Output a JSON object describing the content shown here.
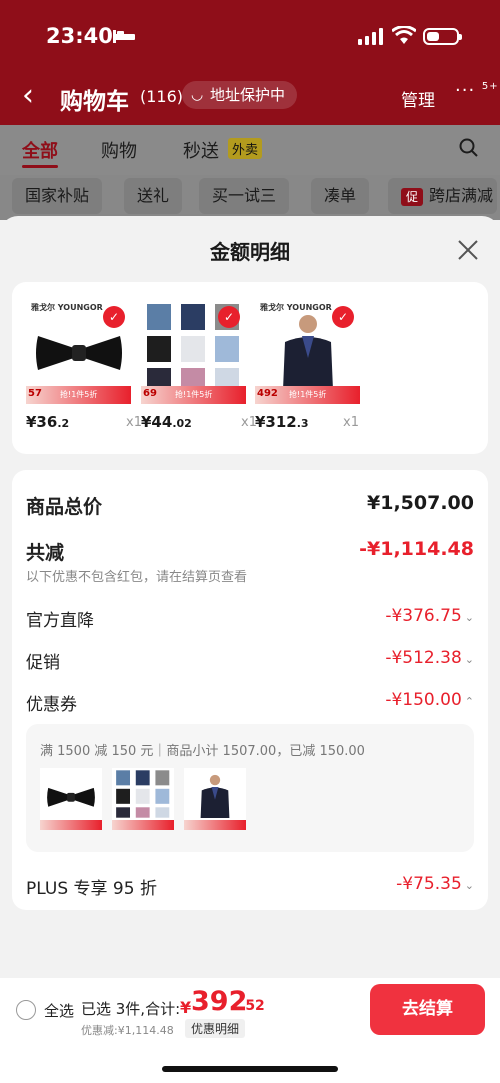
{
  "status": {
    "time": "23:40"
  },
  "header": {
    "back_icon": "chevron-left-icon",
    "title": "购物车",
    "count": "(116)",
    "address_protect": "地址保护中",
    "manage": "管理",
    "more_badge": "5+"
  },
  "tabs": [
    {
      "label": "全部"
    },
    {
      "label": "购物"
    },
    {
      "label": "秒送"
    }
  ],
  "tabs_tag": "外卖",
  "chips": [
    "国家补贴",
    "送礼",
    "买一试三",
    "凑单",
    "跨店满减"
  ],
  "chip_icon": "促",
  "sheet": {
    "title": "金额明细",
    "items": [
      {
        "brand": "雅戈尔 YOUNGOR",
        "banner_num": "57",
        "banner_promo": "抢!1件5折",
        "price_int": "¥36",
        "price_dec": ".2",
        "qty": "x1"
      },
      {
        "brand": "",
        "banner_num": "69",
        "banner_promo": "抢!1件5折",
        "price_int": "¥44",
        "price_dec": ".02",
        "qty": "x1"
      },
      {
        "brand": "雅戈尔 YOUNGOR",
        "banner_num": "492",
        "banner_promo": "抢!1件5折",
        "price_int": "¥312",
        "price_dec": ".3",
        "qty": "x1"
      }
    ],
    "total_label": "商品总价",
    "total_value": "¥1,507.00",
    "reduce_label": "共减",
    "reduce_value": "-¥1,114.48",
    "reduce_note": "以下优惠不包含红包，请在结算页查看",
    "official_label": "官方直降",
    "official_value": "-¥376.75",
    "promo_label": "促销",
    "promo_value": "-¥512.38",
    "coupon_label": "优惠券",
    "coupon_value": "-¥150.00",
    "coupon_desc": "满 1500 减 150 元｜商品小计 1507.00，已减 150.00",
    "plus_label": "PLUS 专享 95 折",
    "plus_value": "-¥75.35"
  },
  "bottom": {
    "select_all": "全选",
    "selected_info": "已选 3件,合计:",
    "total_symbol": "¥",
    "total_int": "392",
    "total_dec": ".52",
    "saved": "优惠减:¥1,114.48",
    "detail_link": "优惠明细",
    "checkout": "去结算"
  },
  "colors": {
    "accent": "#e8202c",
    "header_bg": "#8f0e19"
  }
}
